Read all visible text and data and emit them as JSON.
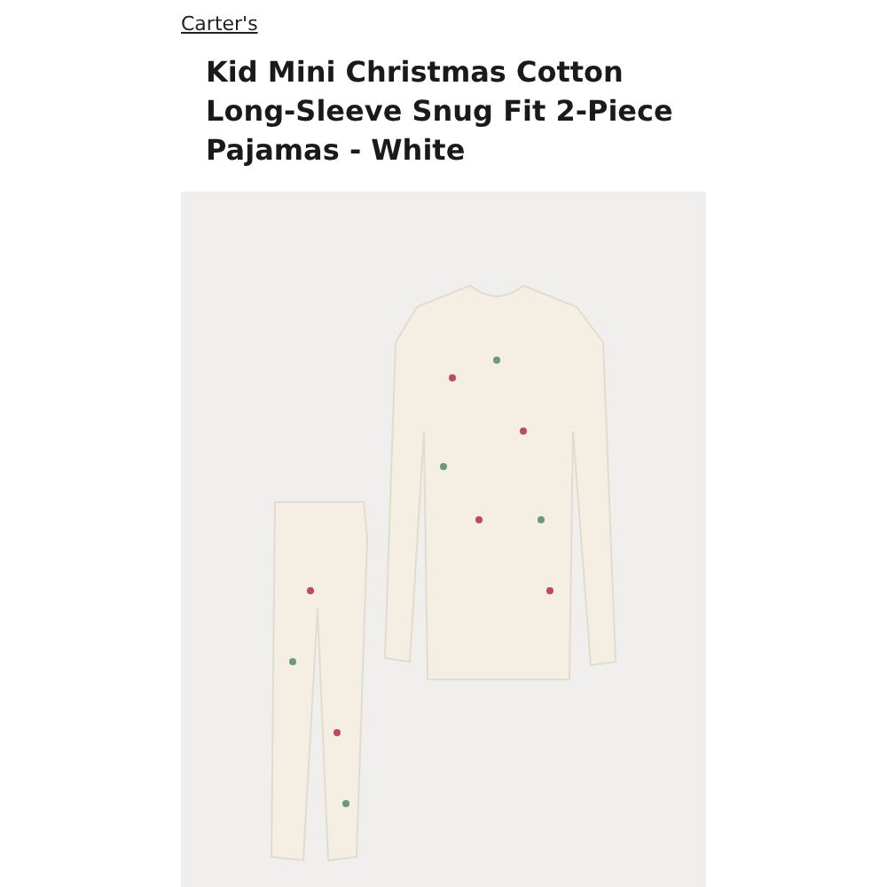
{
  "brand_link": "Carter's",
  "product_title": "Kid Mini Christmas Cotton Long-Sleeve Snug Fit 2-Piece Pajamas - White"
}
